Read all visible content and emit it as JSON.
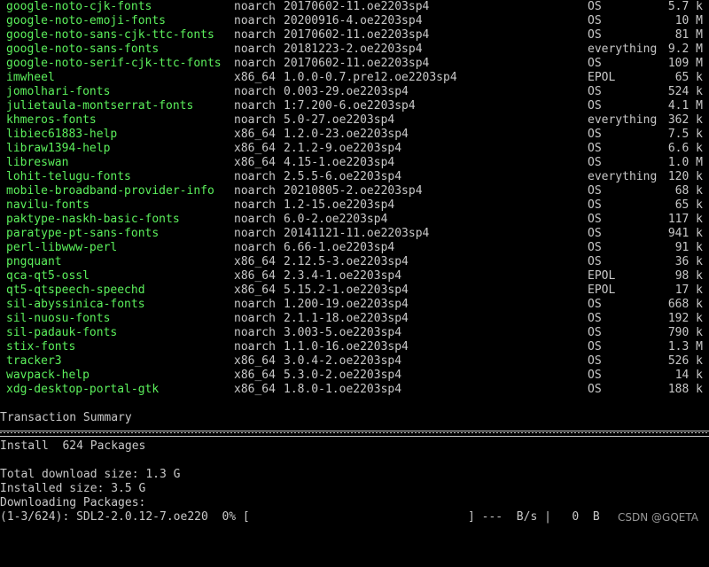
{
  "packages": [
    {
      "name": "google-noto-cjk-fonts",
      "arch": "noarch",
      "version": "20170602-11.oe2203sp4",
      "repo": "OS",
      "size": "5.7 k"
    },
    {
      "name": "google-noto-emoji-fonts",
      "arch": "noarch",
      "version": "20200916-4.oe2203sp4",
      "repo": "OS",
      "size": "10 M"
    },
    {
      "name": "google-noto-sans-cjk-ttc-fonts",
      "arch": "noarch",
      "version": "20170602-11.oe2203sp4",
      "repo": "OS",
      "size": "81 M"
    },
    {
      "name": "google-noto-sans-fonts",
      "arch": "noarch",
      "version": "20181223-2.oe2203sp4",
      "repo": "everything",
      "size": "9.2 M"
    },
    {
      "name": "google-noto-serif-cjk-ttc-fonts",
      "arch": "noarch",
      "version": "20170602-11.oe2203sp4",
      "repo": "OS",
      "size": "109 M"
    },
    {
      "name": "imwheel",
      "arch": "x86_64",
      "version": "1.0.0-0.7.pre12.oe2203sp4",
      "repo": "EPOL",
      "size": "65 k"
    },
    {
      "name": "jomolhari-fonts",
      "arch": "noarch",
      "version": "0.003-29.oe2203sp4",
      "repo": "OS",
      "size": "524 k"
    },
    {
      "name": "julietaula-montserrat-fonts",
      "arch": "noarch",
      "version": "1:7.200-6.oe2203sp4",
      "repo": "OS",
      "size": "4.1 M"
    },
    {
      "name": "khmeros-fonts",
      "arch": "noarch",
      "version": "5.0-27.oe2203sp4",
      "repo": "everything",
      "size": "362 k"
    },
    {
      "name": "libiec61883-help",
      "arch": "x86_64",
      "version": "1.2.0-23.oe2203sp4",
      "repo": "OS",
      "size": "7.5 k"
    },
    {
      "name": "libraw1394-help",
      "arch": "x86_64",
      "version": "2.1.2-9.oe2203sp4",
      "repo": "OS",
      "size": "6.6 k"
    },
    {
      "name": "libreswan",
      "arch": "x86_64",
      "version": "4.15-1.oe2203sp4",
      "repo": "OS",
      "size": "1.0 M"
    },
    {
      "name": "lohit-telugu-fonts",
      "arch": "noarch",
      "version": "2.5.5-6.oe2203sp4",
      "repo": "everything",
      "size": "120 k"
    },
    {
      "name": "mobile-broadband-provider-info",
      "arch": "noarch",
      "version": "20210805-2.oe2203sp4",
      "repo": "OS",
      "size": "68 k"
    },
    {
      "name": "navilu-fonts",
      "arch": "noarch",
      "version": "1.2-15.oe2203sp4",
      "repo": "OS",
      "size": "65 k"
    },
    {
      "name": "paktype-naskh-basic-fonts",
      "arch": "noarch",
      "version": "6.0-2.oe2203sp4",
      "repo": "OS",
      "size": "117 k"
    },
    {
      "name": "paratype-pt-sans-fonts",
      "arch": "noarch",
      "version": "20141121-11.oe2203sp4",
      "repo": "OS",
      "size": "941 k"
    },
    {
      "name": "perl-libwww-perl",
      "arch": "noarch",
      "version": "6.66-1.oe2203sp4",
      "repo": "OS",
      "size": "91 k"
    },
    {
      "name": "pngquant",
      "arch": "x86_64",
      "version": "2.12.5-3.oe2203sp4",
      "repo": "OS",
      "size": "36 k"
    },
    {
      "name": "qca-qt5-ossl",
      "arch": "x86_64",
      "version": "2.3.4-1.oe2203sp4",
      "repo": "EPOL",
      "size": "98 k"
    },
    {
      "name": "qt5-qtspeech-speechd",
      "arch": "x86_64",
      "version": "5.15.2-1.oe2203sp4",
      "repo": "EPOL",
      "size": "17 k"
    },
    {
      "name": "sil-abyssinica-fonts",
      "arch": "noarch",
      "version": "1.200-19.oe2203sp4",
      "repo": "OS",
      "size": "668 k"
    },
    {
      "name": "sil-nuosu-fonts",
      "arch": "noarch",
      "version": "2.1.1-18.oe2203sp4",
      "repo": "OS",
      "size": "192 k"
    },
    {
      "name": "sil-padauk-fonts",
      "arch": "noarch",
      "version": "3.003-5.oe2203sp4",
      "repo": "OS",
      "size": "790 k"
    },
    {
      "name": "stix-fonts",
      "arch": "noarch",
      "version": "1.1.0-16.oe2203sp4",
      "repo": "OS",
      "size": "1.3 M"
    },
    {
      "name": "tracker3",
      "arch": "x86_64",
      "version": "3.0.4-2.oe2203sp4",
      "repo": "OS",
      "size": "526 k"
    },
    {
      "name": "wavpack-help",
      "arch": "x86_64",
      "version": "5.3.0-2.oe2203sp4",
      "repo": "OS",
      "size": "14 k"
    },
    {
      "name": "xdg-desktop-portal-gtk",
      "arch": "x86_64",
      "version": "1.8.0-1.oe2203sp4",
      "repo": "OS",
      "size": "188 k"
    }
  ],
  "summary": {
    "heading": "Transaction Summary",
    "install_line": "Install  624 Packages",
    "total_download": "Total download size: 1.3 G",
    "installed_size": "Installed size: 3.5 G",
    "downloading": "Downloading Packages:"
  },
  "progress": {
    "left_text": "(1-3/624): SDL2-2.0.12-7.oe220  0% [",
    "right_text": "] ---  B/s |   0  B",
    "percent": 0
  },
  "watermark": "CSDN @GQETA",
  "colors": {
    "background": "#000000",
    "package_name": "#5cf05c",
    "text": "#c8c8c8"
  }
}
